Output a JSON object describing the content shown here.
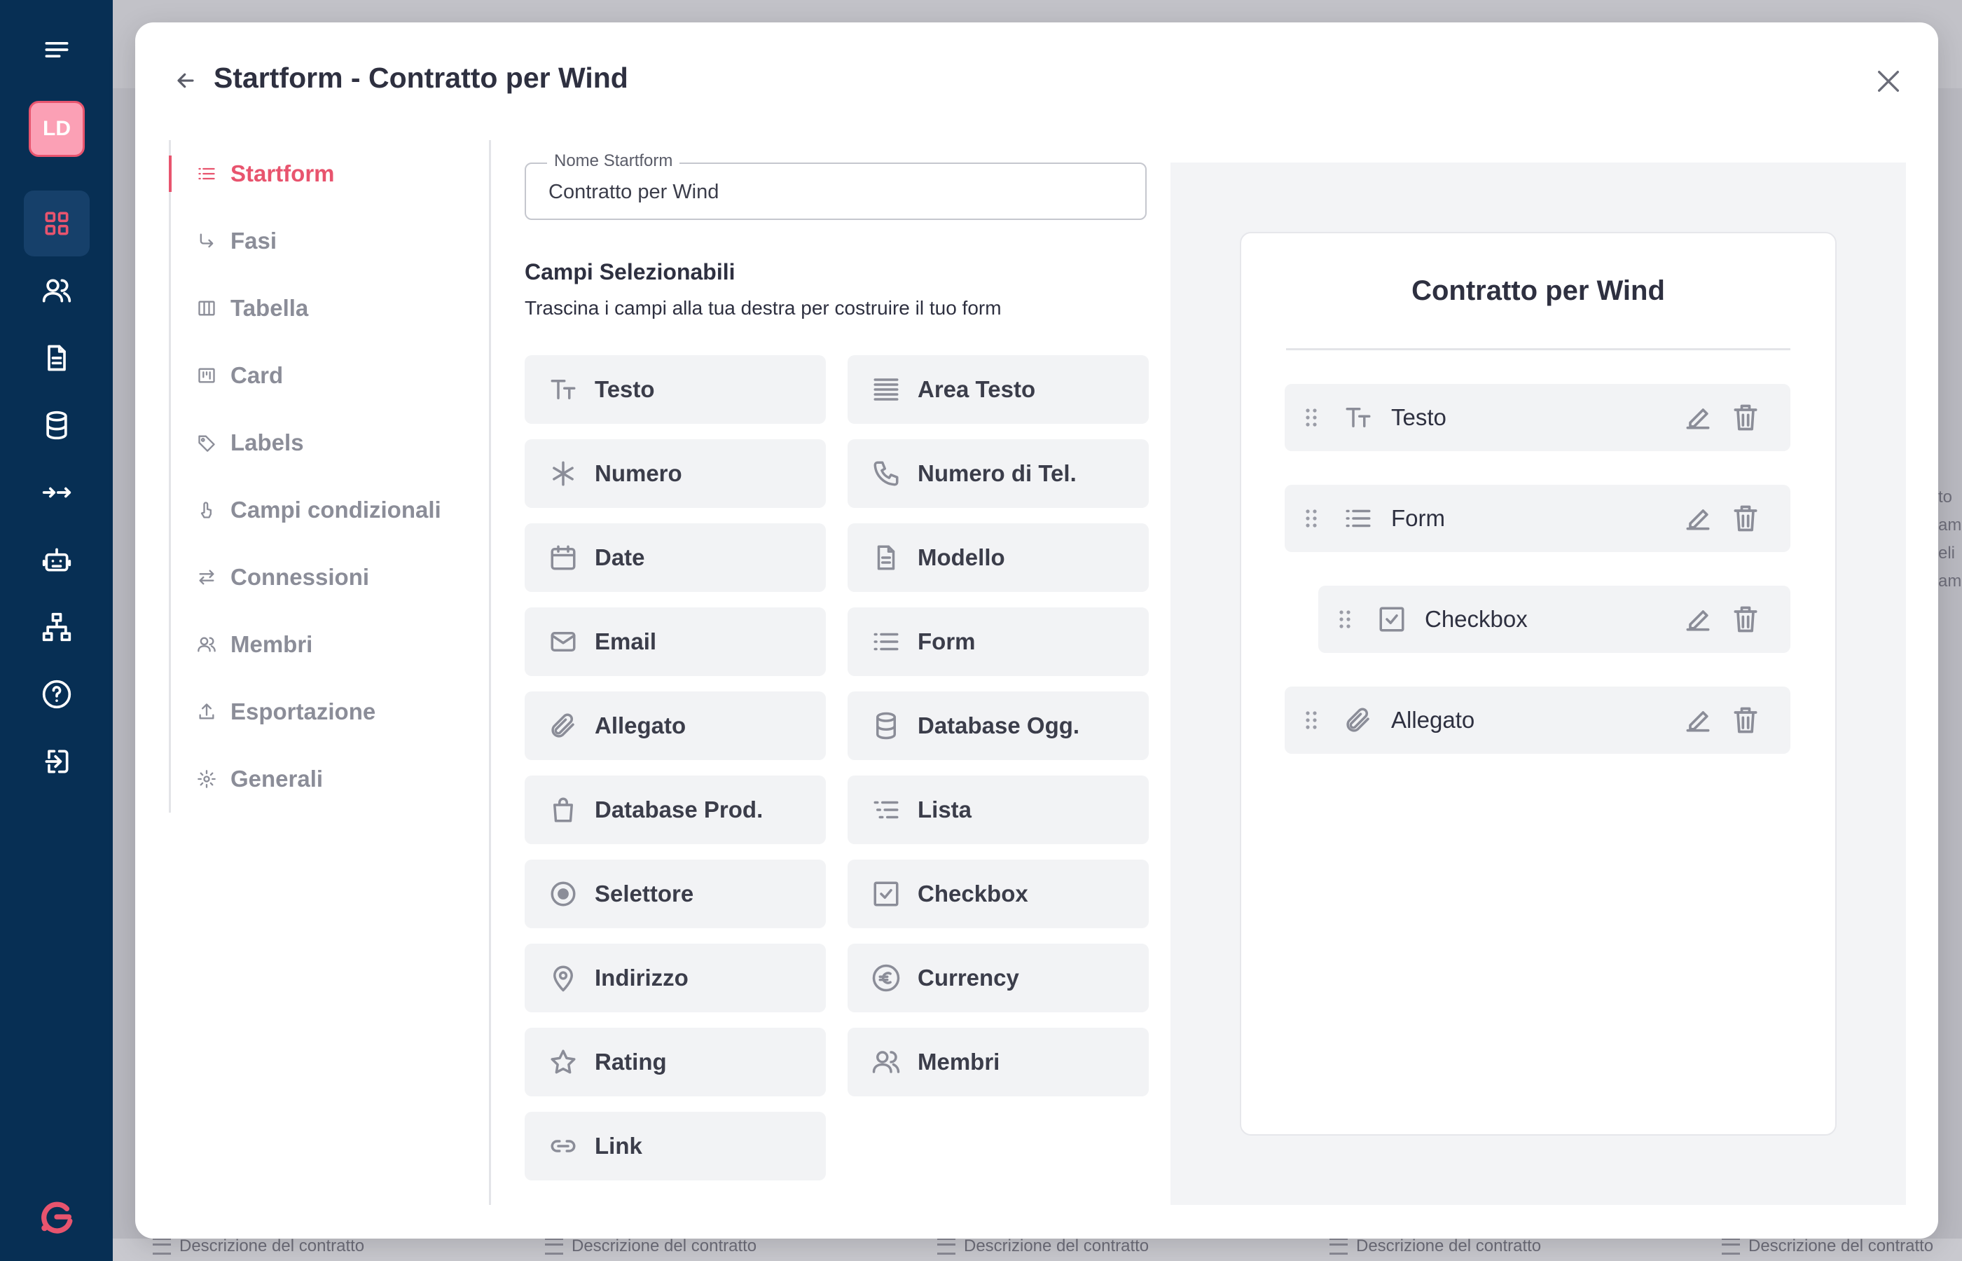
{
  "app": {
    "user_initials": "LD",
    "accent_color": "#e8546e",
    "rail_color": "#072f54",
    "rail_icons": [
      "menu-icon",
      "dashboard-icon",
      "users-icon",
      "document-icon",
      "database-icon",
      "arrows-icon",
      "robot-icon",
      "sitemap-icon",
      "help-icon",
      "logout-icon"
    ]
  },
  "modal": {
    "title": "Startform - Contratto per Wind"
  },
  "nav": {
    "items": [
      {
        "label": "Startform",
        "icon": "list-icon",
        "active": true
      },
      {
        "label": "Fasi",
        "icon": "arrow-turn-icon",
        "active": false
      },
      {
        "label": "Tabella",
        "icon": "table-icon",
        "active": false
      },
      {
        "label": "Card",
        "icon": "card-icon",
        "active": false
      },
      {
        "label": "Labels",
        "icon": "tag-icon",
        "active": false
      },
      {
        "label": "Campi condizionali",
        "icon": "pointer-icon",
        "active": false
      },
      {
        "label": "Connessioni",
        "icon": "swap-icon",
        "active": false
      },
      {
        "label": "Membri",
        "icon": "users-icon",
        "active": false
      },
      {
        "label": "Esportazione",
        "icon": "upload-icon",
        "active": false
      },
      {
        "label": "Generali",
        "icon": "gear-icon",
        "active": false
      }
    ]
  },
  "form": {
    "name_label": "Nome Startform",
    "name_value": "Contratto per Wind",
    "fields_title": "Campi Selezionabili",
    "fields_subtitle": "Trascina i campi alla tua destra per costruire il tuo form"
  },
  "palette": [
    {
      "label": "Testo",
      "icon": "text-icon"
    },
    {
      "label": "Area Testo",
      "icon": "text-area-icon"
    },
    {
      "label": "Numero",
      "icon": "asterisk-icon"
    },
    {
      "label": "Numero di Tel.",
      "icon": "phone-icon"
    },
    {
      "label": "Date",
      "icon": "calendar-icon"
    },
    {
      "label": "Modello",
      "icon": "document-icon"
    },
    {
      "label": "Email",
      "icon": "mail-icon"
    },
    {
      "label": "Form",
      "icon": "list-icon"
    },
    {
      "label": "Allegato",
      "icon": "paperclip-icon"
    },
    {
      "label": "Database Ogg.",
      "icon": "database-icon"
    },
    {
      "label": "Database Prod.",
      "icon": "shopping-bag-icon"
    },
    {
      "label": "Lista",
      "icon": "list-bullets-icon"
    },
    {
      "label": "Selettore",
      "icon": "radio-icon"
    },
    {
      "label": "Checkbox",
      "icon": "checkbox-icon"
    },
    {
      "label": "Indirizzo",
      "icon": "map-pin-icon"
    },
    {
      "label": "Currency",
      "icon": "euro-icon"
    },
    {
      "label": "Rating",
      "icon": "star-icon"
    },
    {
      "label": "Membri",
      "icon": "users-icon"
    },
    {
      "label": "Link",
      "icon": "link-icon"
    }
  ],
  "preview": {
    "title": "Contratto per Wind",
    "fields": [
      {
        "label": "Testo",
        "icon": "text-icon",
        "nested": false
      },
      {
        "label": "Form",
        "icon": "list-icon",
        "nested": false
      },
      {
        "label": "Checkbox",
        "icon": "checkbox-icon",
        "nested": true
      },
      {
        "label": "Allegato",
        "icon": "paperclip-icon",
        "nested": false
      }
    ]
  },
  "background": {
    "card_descriptions": [
      "Descrizione del contratto",
      "Descrizione del contratto",
      "Descrizione del contratto",
      "Descrizione del contratto",
      "Descrizione del contratto"
    ],
    "peek_text": [
      "to",
      "ame",
      "eli",
      "ame"
    ]
  }
}
